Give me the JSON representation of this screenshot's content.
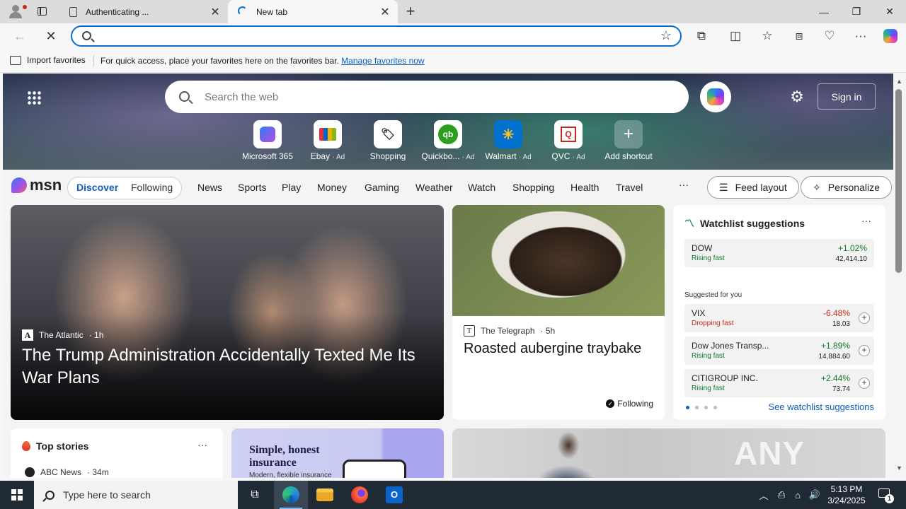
{
  "browser": {
    "tabs": [
      {
        "title": "Authenticating ...",
        "state": "inactive",
        "icon": "document-icon"
      },
      {
        "title": "New tab",
        "state": "active",
        "icon": "loading-spinner-icon"
      }
    ],
    "address_value": "",
    "favorites_bar": {
      "import_label": "Import favorites",
      "message": "For quick access, place your favorites here on the favorites bar.",
      "link": "Manage favorites now"
    }
  },
  "newtab": {
    "search_placeholder": "Search the web",
    "sign_in": "Sign in",
    "shortcuts": [
      {
        "label": "Microsoft 365",
        "ad": ""
      },
      {
        "label": "Ebay",
        "ad": "· Ad"
      },
      {
        "label": "Shopping",
        "ad": ""
      },
      {
        "label": "Quickbo...",
        "ad": "· Ad"
      },
      {
        "label": "Walmart",
        "ad": "· Ad"
      },
      {
        "label": "QVC",
        "ad": "· Ad"
      },
      {
        "label": "Add shortcut",
        "ad": ""
      }
    ]
  },
  "msn": {
    "logo": "msn",
    "segments": [
      "Discover",
      "Following"
    ],
    "nav": [
      "News",
      "Sports",
      "Play",
      "Money",
      "Gaming",
      "Weather",
      "Watch",
      "Shopping",
      "Health",
      "Travel"
    ],
    "more": "···",
    "feed_layout": "Feed layout",
    "personalize": "Personalize"
  },
  "hero_story": {
    "source": "The Atlantic",
    "source_logo": "A",
    "age": "· 1h",
    "headline": "The Trump Administration Accidentally Texted Me Its War Plans"
  },
  "food_story": {
    "source": "The Telegraph",
    "source_logo": "T",
    "age": "· 5h",
    "headline": "Roasted aubergine traybake",
    "following": "Following"
  },
  "watchlist": {
    "title": "Watchlist suggestions",
    "more": "···",
    "top": {
      "name": "DOW",
      "status": "Rising fast",
      "pct": "+1.02%",
      "price": "42,414.10",
      "direction": "up"
    },
    "subtitle": "Suggested for you",
    "items": [
      {
        "name": "VIX",
        "status": "Dropping fast",
        "pct": "-6.48%",
        "price": "18.03",
        "direction": "down"
      },
      {
        "name": "Dow Jones Transp...",
        "status": "Rising fast",
        "pct": "+1.89%",
        "price": "14,884.60",
        "direction": "up"
      },
      {
        "name": "CITIGROUP INC.",
        "status": "Rising fast",
        "pct": "+2.44%",
        "price": "73.74",
        "direction": "up"
      }
    ],
    "see_all": "See watchlist suggestions"
  },
  "top_stories": {
    "title": "Top stories",
    "more": "···",
    "first_source": "ABC News",
    "first_age": "· 34m"
  },
  "ad": {
    "headline": "Simple, honest insurance",
    "sub": "Modern, flexible insurance"
  },
  "watermark": "ANY RUN",
  "taskbar": {
    "search_placeholder": "Type here to search",
    "time": "5:13 PM",
    "date": "3/24/2025",
    "notifications": "1"
  },
  "colors": {
    "accent": "#0a6ed1",
    "rising": "#137a2b",
    "dropping": "#c42b1c",
    "link": "#0f5fbf"
  }
}
